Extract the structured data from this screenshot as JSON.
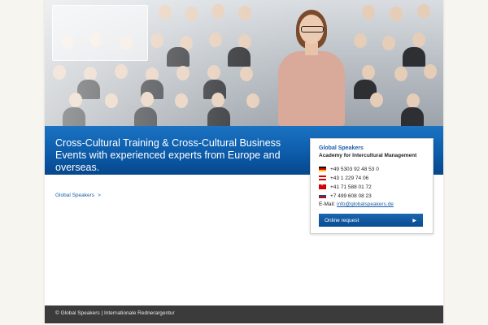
{
  "band": {
    "headline": "Cross-Cultural Training & Cross-Cultural Business Events with experienced experts from Europe and overseas."
  },
  "breadcrumb": {
    "item": "Global Speakers",
    "separator": ">"
  },
  "contact": {
    "title": "Global Speakers",
    "subtitle": "Academy for Intercultural Management",
    "phones": [
      {
        "country": "de",
        "number": "+49 5303 92 48 53 0"
      },
      {
        "country": "at",
        "number": "+43 1 229 74 06"
      },
      {
        "country": "ch",
        "number": "+41 71 588 01 72"
      },
      {
        "country": "ru",
        "number": "+7 499 608 08 23"
      }
    ],
    "email_label": "E-Mail:",
    "email": "info@globalspeakers.de",
    "button_label": "Online request"
  },
  "footer": {
    "text": "© Global Speakers | Internationale Rednerargentur"
  },
  "colors": {
    "accent_blue": "#0b5aa8",
    "footer_bg": "#3b3b3b",
    "page_bg": "#f7f5f0"
  }
}
